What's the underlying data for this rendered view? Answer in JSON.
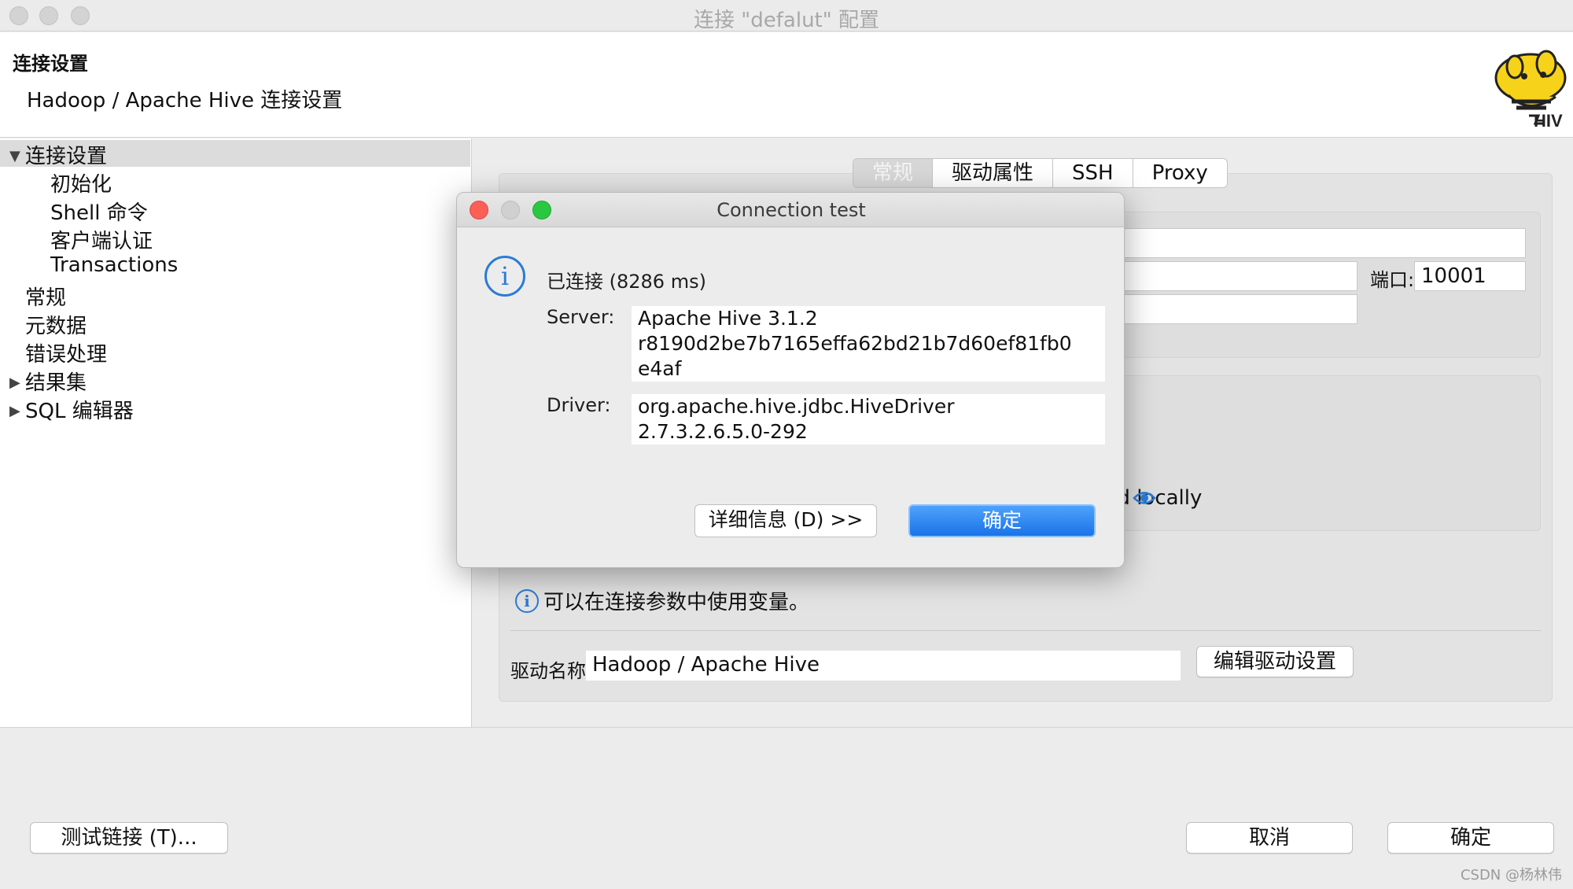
{
  "window": {
    "title": "连接 \"defalut\" 配置"
  },
  "header": {
    "title": "连接设置",
    "subtitle": "Hadoop / Apache Hive 连接设置"
  },
  "tree": {
    "items": [
      {
        "label": "连接设置",
        "expanded": true,
        "selected": true
      },
      {
        "label": "初始化"
      },
      {
        "label": "Shell 命令"
      },
      {
        "label": "客户端认证"
      },
      {
        "label": "Transactions"
      },
      {
        "label": "常规"
      },
      {
        "label": "元数据"
      },
      {
        "label": "错误处理"
      },
      {
        "label": "结果集",
        "expanded": false
      },
      {
        "label": "SQL 编辑器",
        "expanded": false
      }
    ]
  },
  "tabs": [
    {
      "label": "常规",
      "active": true
    },
    {
      "label": "驱动属性"
    },
    {
      "label": "SSH"
    },
    {
      "label": "Proxy"
    }
  ],
  "form": {
    "port_label": "端口:",
    "port_value": "10001",
    "save_password_partial": "assword locally",
    "variables_hint": "可以在连接参数中使用变量。",
    "driver_name_label": "驱动名称:",
    "driver_name_value": "Hadoop / Apache Hive",
    "edit_driver_button": "编辑驱动设置"
  },
  "footer": {
    "test_button": "测试链接 (T)...",
    "cancel_button": "取消",
    "ok_button": "确定",
    "watermark": "CSDN @杨林伟"
  },
  "dialog": {
    "title": "Connection test",
    "status": "已连接 (8286 ms)",
    "server_label": "Server:",
    "server_lines": [
      "Apache Hive 3.1.2",
      "r8190d2be7b7165effa62bd21b7d60ef81fb0",
      "e4af"
    ],
    "driver_label": "Driver:",
    "driver_lines": [
      "org.apache.hive.jdbc.HiveDriver",
      "2.7.3.2.6.5.0-292"
    ],
    "details_button": "详细信息 (D) >>",
    "ok_button": "确定"
  },
  "colors": {
    "accent": "#1a73e8",
    "info": "#2a7bd6",
    "close": "#fc5f57",
    "minimize": "#d0d0d0",
    "zoom": "#2ac840"
  }
}
